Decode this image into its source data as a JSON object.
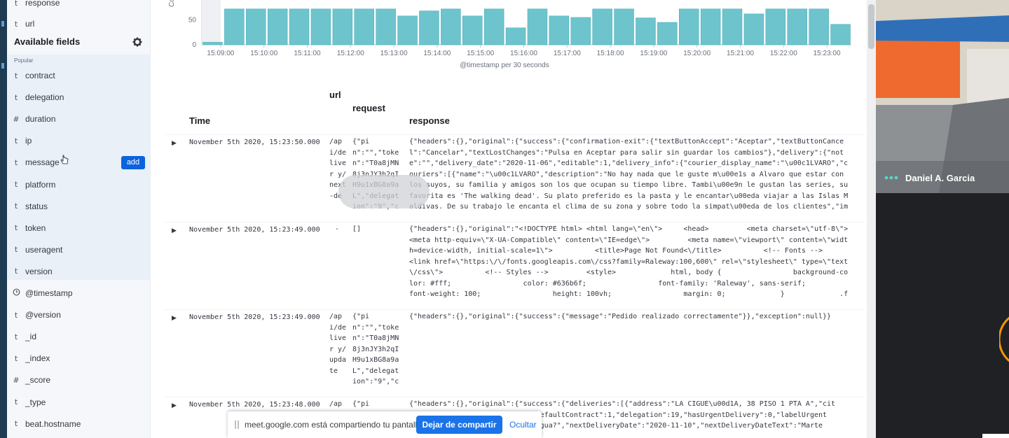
{
  "sidebar": {
    "selected": [
      {
        "type": "t",
        "name": "response"
      },
      {
        "type": "t",
        "name": "url"
      }
    ],
    "available_title": "Available fields",
    "popular_label": "Popular",
    "add_label": "add",
    "popular": [
      {
        "type": "t",
        "name": "contract"
      },
      {
        "type": "t",
        "name": "delegation"
      },
      {
        "type": "#",
        "name": "duration"
      },
      {
        "type": "t",
        "name": "ip"
      },
      {
        "type": "t",
        "name": "message"
      },
      {
        "type": "t",
        "name": "platform"
      },
      {
        "type": "t",
        "name": "status"
      },
      {
        "type": "t",
        "name": "token"
      },
      {
        "type": "t",
        "name": "useragent"
      },
      {
        "type": "t",
        "name": "version"
      }
    ],
    "others": [
      {
        "type": "clock",
        "name": "@timestamp"
      },
      {
        "type": "t",
        "name": "@version"
      },
      {
        "type": "t",
        "name": "_id"
      },
      {
        "type": "t",
        "name": "_index"
      },
      {
        "type": "#",
        "name": "_score"
      },
      {
        "type": "t",
        "name": "_type"
      },
      {
        "type": "t",
        "name": "beat.hostname"
      }
    ]
  },
  "chart_data": {
    "type": "bar",
    "ylabel": "Count",
    "xlabel": "@timestamp per 30 seconds",
    "y_ticks": [
      0,
      50
    ],
    "x_ticks": [
      "15:09:00",
      "15:10:00",
      "15:11:00",
      "15:12:00",
      "15:13:00",
      "15:14:00",
      "15:15:00",
      "15:16:00",
      "15:17:00",
      "15:18:00",
      "15:19:00",
      "15:20:00",
      "15:21:00",
      "15:22:00",
      "15:23:00"
    ],
    "values": [
      5,
      72,
      72,
      72,
      72,
      72,
      72,
      72,
      72,
      58,
      68,
      72,
      58,
      72,
      34,
      72,
      58,
      55,
      72,
      72,
      54,
      45,
      72,
      72,
      72,
      62,
      72,
      72,
      72,
      41
    ],
    "bar_color": "#6dc4cd"
  },
  "table": {
    "headers": {
      "time": "Time",
      "url": "url",
      "request": "request",
      "response": "response"
    },
    "rows": [
      {
        "time": "November 5th 2020, 15:23:50.000",
        "url": "/api/deliver y/next-de",
        "request": "{\"pin\":\"\",\"token\":\"T0a8jMN8j3nJY3h2qIH9u1xBG8a9aL\",\"delegation\":\"9\",\"c",
        "response": "{\"headers\":{},\"original\":{\"success\":{\"confirmation-exit\":{\"textButtonAccept\":\"Aceptar\",\"textButtonCancel\":\"Cancelar\",\"textLostChanges\":\"Pulsa en Aceptar para salir sin guardar los cambios\"},\"delivery\":{\"note\":\"\",\"delivery_date\":\"2020-11-06\",\"editable\":1,\"delivery_info\":{\"courier_display_name\":\"\\u00c1LVARO\",\"couriers\":[{\"name\":\"\\u00c1LVARO\",\"description\":\"No hay nada que le guste m\\u00e1s a Alvaro que estar con los suyos, su familia y amigos son los que ocupan su tiempo libre. Tambi\\u00e9n le gustan las series, su favorita es 'The walking dead'. Su plato preferido es la pasta y le encantar\\u00eda viajar a las Islas Maldivas. De su trabajo le encanta el clima de su zona y sobre todo la simpat\\u00eda de los clientes\",\"image"
      },
      {
        "time": "November 5th 2020, 15:23:49.000",
        "url": "-",
        "request": "[]",
        "response": "{\"headers\":{},\"original\":\"<!DOCTYPE html> <html lang=\\\"en\\\">     <head>         <meta charset=\\\"utf-8\\\">         <meta http-equiv=\\\"X-UA-Compatible\\\" content=\\\"IE=edge\\\">         <meta name=\\\"viewport\\\" content=\\\"width=device-width, initial-scale=1\\\">          <title>Page Not Found<\\/title>          <!-- Fonts -->         <link href=\\\"https:\\/\\/fonts.googleapis.com\\/css?family=Raleway:100,600\\\" rel=\\\"stylesheet\\\" type=\\\"text\\/css\\\">          <!-- Styles -->         <style>             html, body {                 background-color: #fff;                 color: #636b6f;                 font-family: 'Raleway', sans-serif;                 font-weight: 100;                 height: 100vh;                 margin: 0;             }             .f"
      },
      {
        "time": "November 5th 2020, 15:23:49.000",
        "url": "/api/deliver y/update",
        "request": "{\"pin\":\"\",\"token\":\"T0a8jMN8j3nJY3h2qIH9u1xBG8a9aL\",\"delegation\":\"9\",\"c",
        "response": "{\"headers\":{},\"original\":{\"success\":{\"message\":\"Pedido realizado correctamente\"}},\"exception\":null}}"
      },
      {
        "time": "November 5th 2020, 15:23:48.000",
        "url": "/ap",
        "request": "{\"pi",
        "response": "{\"headers\":{},\"original\":{\"success\":{\"deliveries\":[{\"address\":\"LA CIGUE\\u00d1A, 38 PISO 1 PTA A\",\"cit\n                          85,\"defaultContract\":1,\"delegation\":19,\"hasUrgentDelivery\":0,\"labelUrgent\n                          sin agua?\",\"nextDeliveryDate\":\"2020-11-10\",\"nextDeliveryDateText\":\"Marte"
      }
    ]
  },
  "video": {
    "participant": "Daniel A. Garcia"
  },
  "share_bar": {
    "message": "meet.google.com está compartiendo tu pantalla.",
    "stop_label": "Dejar de compartir",
    "hide_label": "Ocultar"
  }
}
